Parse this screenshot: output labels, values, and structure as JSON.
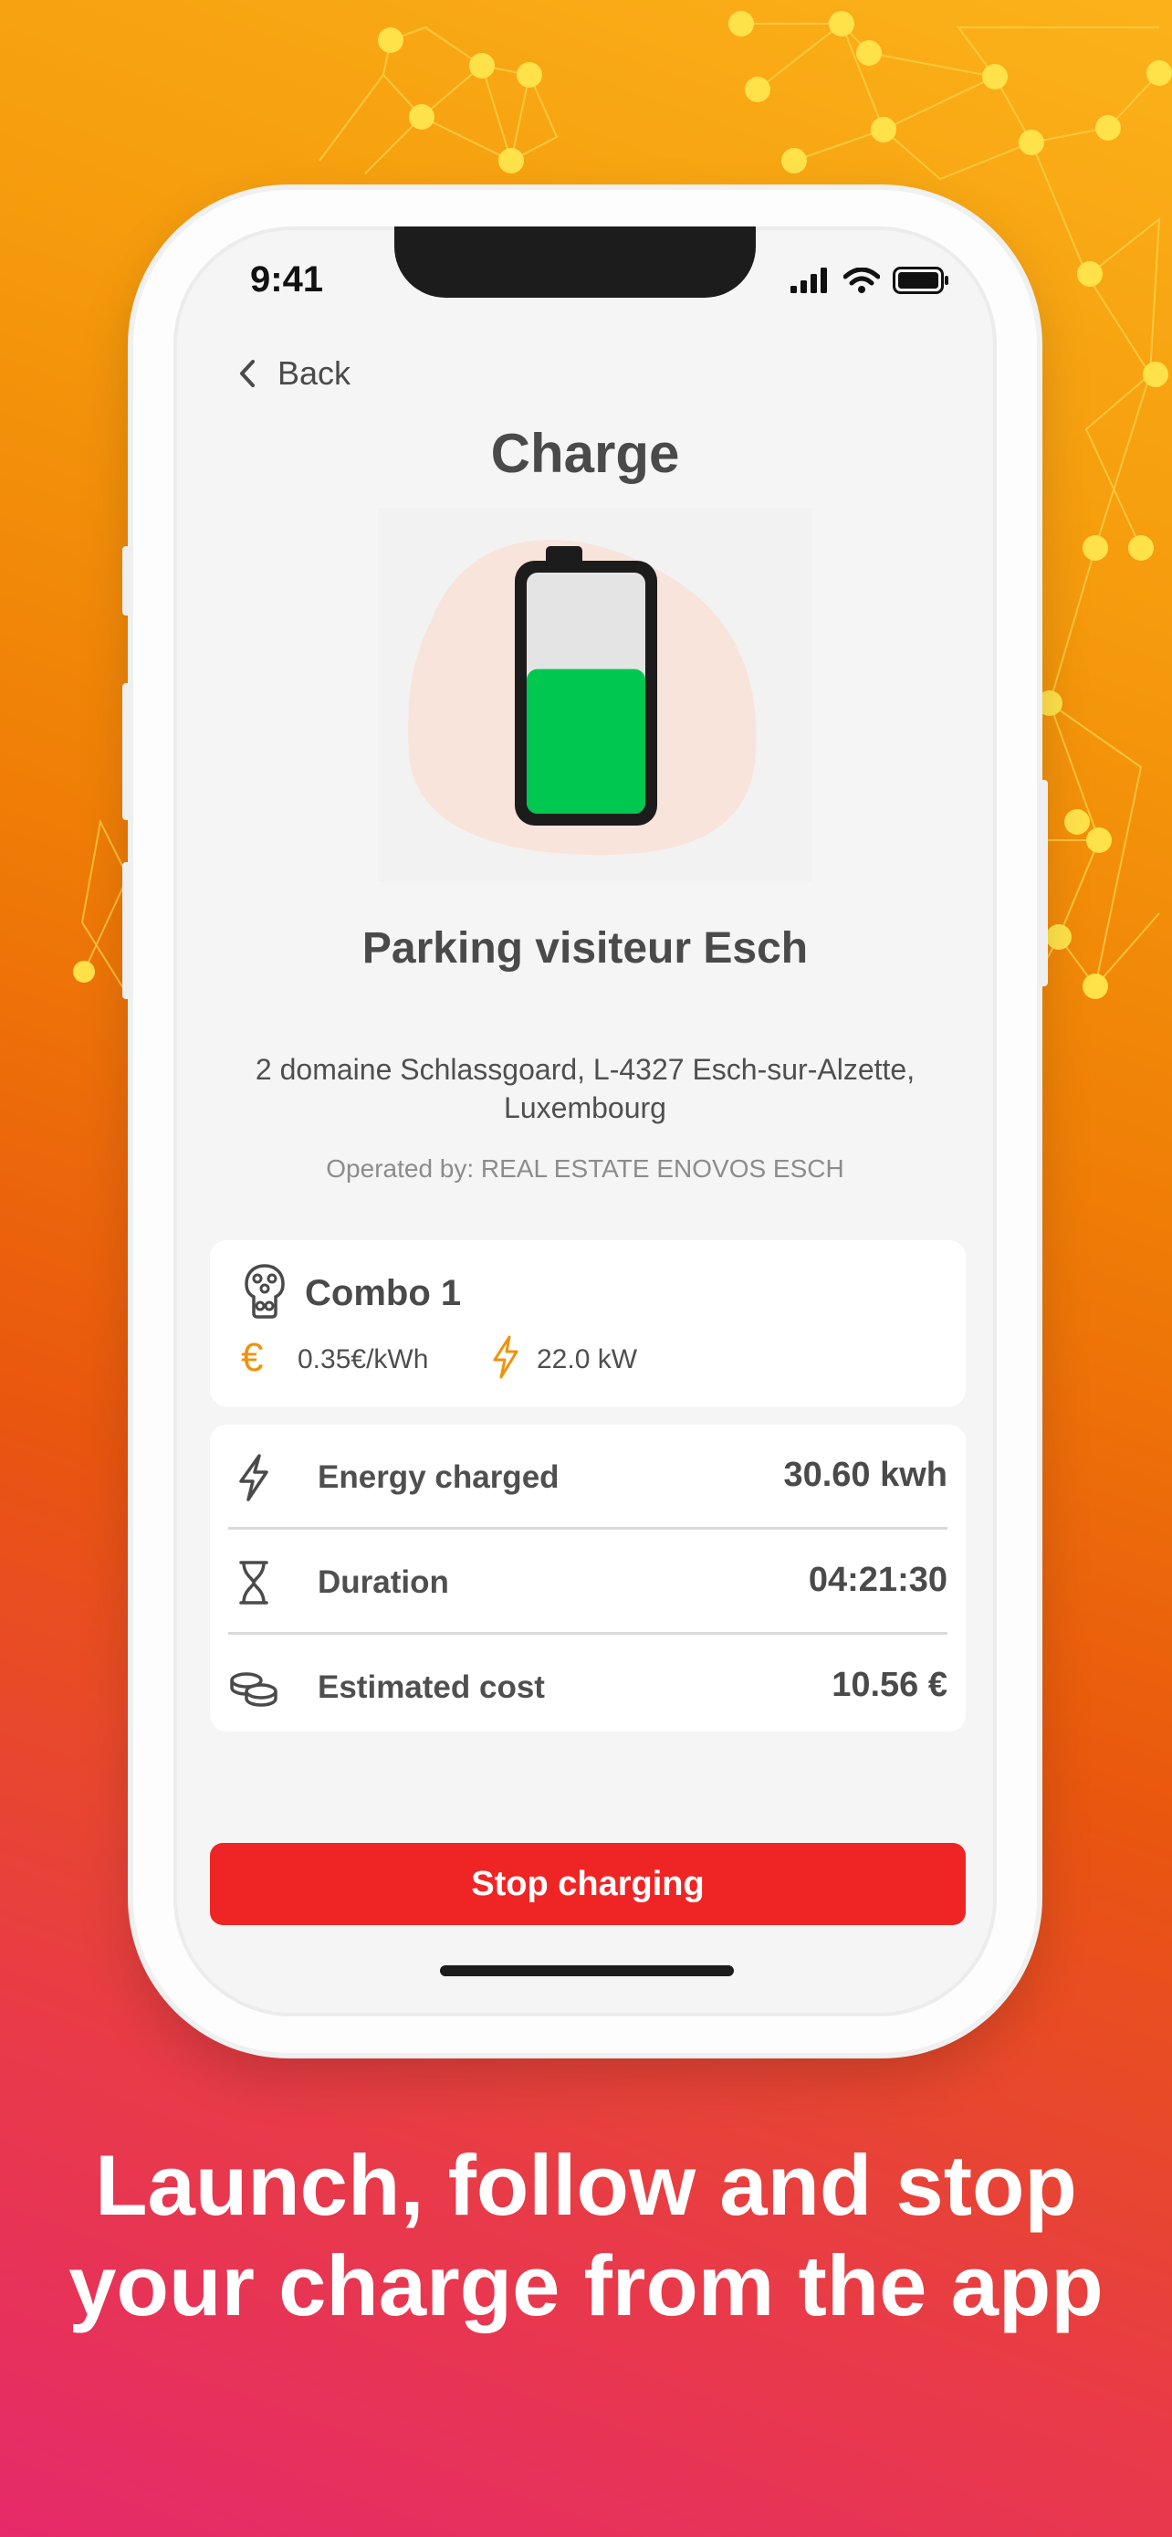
{
  "status": {
    "time": "9:41"
  },
  "nav": {
    "back_label": "Back"
  },
  "page": {
    "title": "Charge"
  },
  "battery": {
    "level_fraction": 0.6,
    "fill_color": "#00c74f",
    "blob_color": "#f9e4dc"
  },
  "station": {
    "name": "Parking visiteur Esch",
    "address": "2 domaine Schlassgoard, L-4327 Esch-sur-Alzette, Luxembourg",
    "operator": "Operated by:  REAL ESTATE ENOVOS ESCH"
  },
  "connector": {
    "name": "Combo 1",
    "price": "0.35€/kWh",
    "price_icon": "€",
    "power": "22.0 kW"
  },
  "stats": [
    {
      "icon": "lightning-icon",
      "label": "Energy charged",
      "value": "30.60 kwh"
    },
    {
      "icon": "hourglass-icon",
      "label": "Duration",
      "value": "04:21:30"
    },
    {
      "icon": "coins-icon",
      "label": "Estimated cost",
      "value": "10.56 €"
    }
  ],
  "actions": {
    "stop_label": "Stop charging"
  },
  "tagline": "Launch, follow and stop your charge from the app",
  "colors": {
    "accent_orange": "#f0920a",
    "stop_red": "#ef2525",
    "text_dark": "#4a4a4a"
  }
}
